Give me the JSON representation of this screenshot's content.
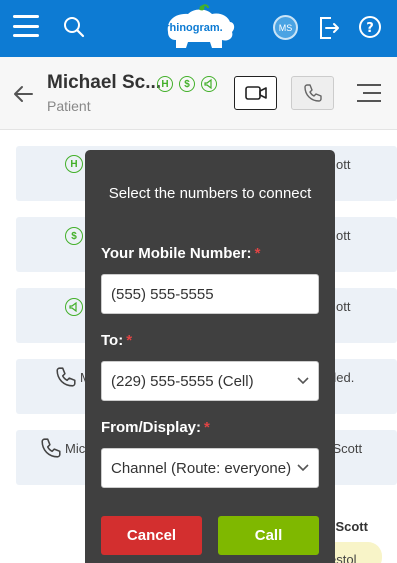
{
  "topbar": {
    "logo_text": "rhinogram.",
    "avatar_initials": "MS",
    "icons": [
      "menu-icon",
      "search-icon",
      "logout-icon",
      "help-icon"
    ],
    "brand_color": "#0d7bd3"
  },
  "patient": {
    "name": "Michael Sc...",
    "role": "Patient",
    "badges": [
      "H",
      "$",
      "megaphone"
    ]
  },
  "feed": {
    "cards": [
      {
        "icon": "hipaa-badge-icon",
        "text": "ott"
      },
      {
        "icon": "dollar-badge-icon",
        "text": "ott"
      },
      {
        "icon": "megaphone-badge-icon",
        "text": "ott"
      },
      {
        "icon": "phone-icon",
        "text_left": "M",
        "text_right": "ded."
      },
      {
        "icon": "phone-icon",
        "text_left": "Mic",
        "text_right": "l Scott"
      }
    ],
    "footer_name": "el Scott",
    "footer_bubble": "estol"
  },
  "modal": {
    "title": "Select the numbers to connect",
    "mobile_label": "Your Mobile Number:",
    "mobile_value": "(555) 555-5555",
    "to_label": "To:",
    "to_value": "(229) 555-5555 (Cell)",
    "from_label": "From/Display:",
    "from_value": "Channel (Route: everyone)",
    "required_mark": "*",
    "cancel_label": "Cancel",
    "call_label": "Call",
    "cancel_color": "#d32f2f",
    "call_color": "#7fb800"
  }
}
